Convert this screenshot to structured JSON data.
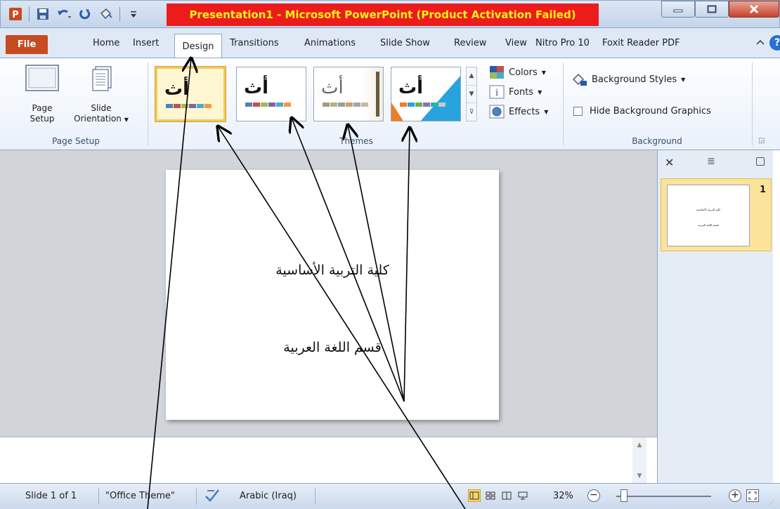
{
  "titlebar": {
    "title": "Presentation1  -  Microsoft PowerPoint (Product Activation Failed)",
    "app_icon_letter": "P",
    "title_bg_color": "#ed1c1c",
    "title_text_color": "#f6f61a"
  },
  "tabs": {
    "file": "File",
    "home": "Home",
    "insert": "Insert",
    "design": "Design",
    "transitions": "Transitions",
    "animations": "Animations",
    "slideshow": "Slide Show",
    "review": "Review",
    "view": "View",
    "nitro": "Nitro Pro 10",
    "foxit": "Foxit Reader PDF",
    "help_icon": "?"
  },
  "ribbon": {
    "page_setup": {
      "page_setup_label_1": "Page",
      "page_setup_label_2": "Setup",
      "orientation_label_1": "Slide",
      "orientation_label_2": "Orientation",
      "group_label": "Page Setup"
    },
    "themes": {
      "group_label": "Themes",
      "thumb_glyph": "أث",
      "colors": "Colors",
      "fonts": "Fonts",
      "effects": "Effects"
    },
    "background": {
      "styles": "Background Styles",
      "hide_graphics": "Hide Background Graphics",
      "group_label": "Background"
    }
  },
  "slide": {
    "title": "كلية التربية الأساسية",
    "subtitle": "قسم اللغة العربية"
  },
  "slides_pane": {
    "slide_number": "1"
  },
  "statusbar": {
    "slide_info": "Slide 1 of 1",
    "theme": "\"Office Theme\"",
    "language": "Arabic (Iraq)",
    "zoom": "32%",
    "zoom_level": 0.32
  }
}
